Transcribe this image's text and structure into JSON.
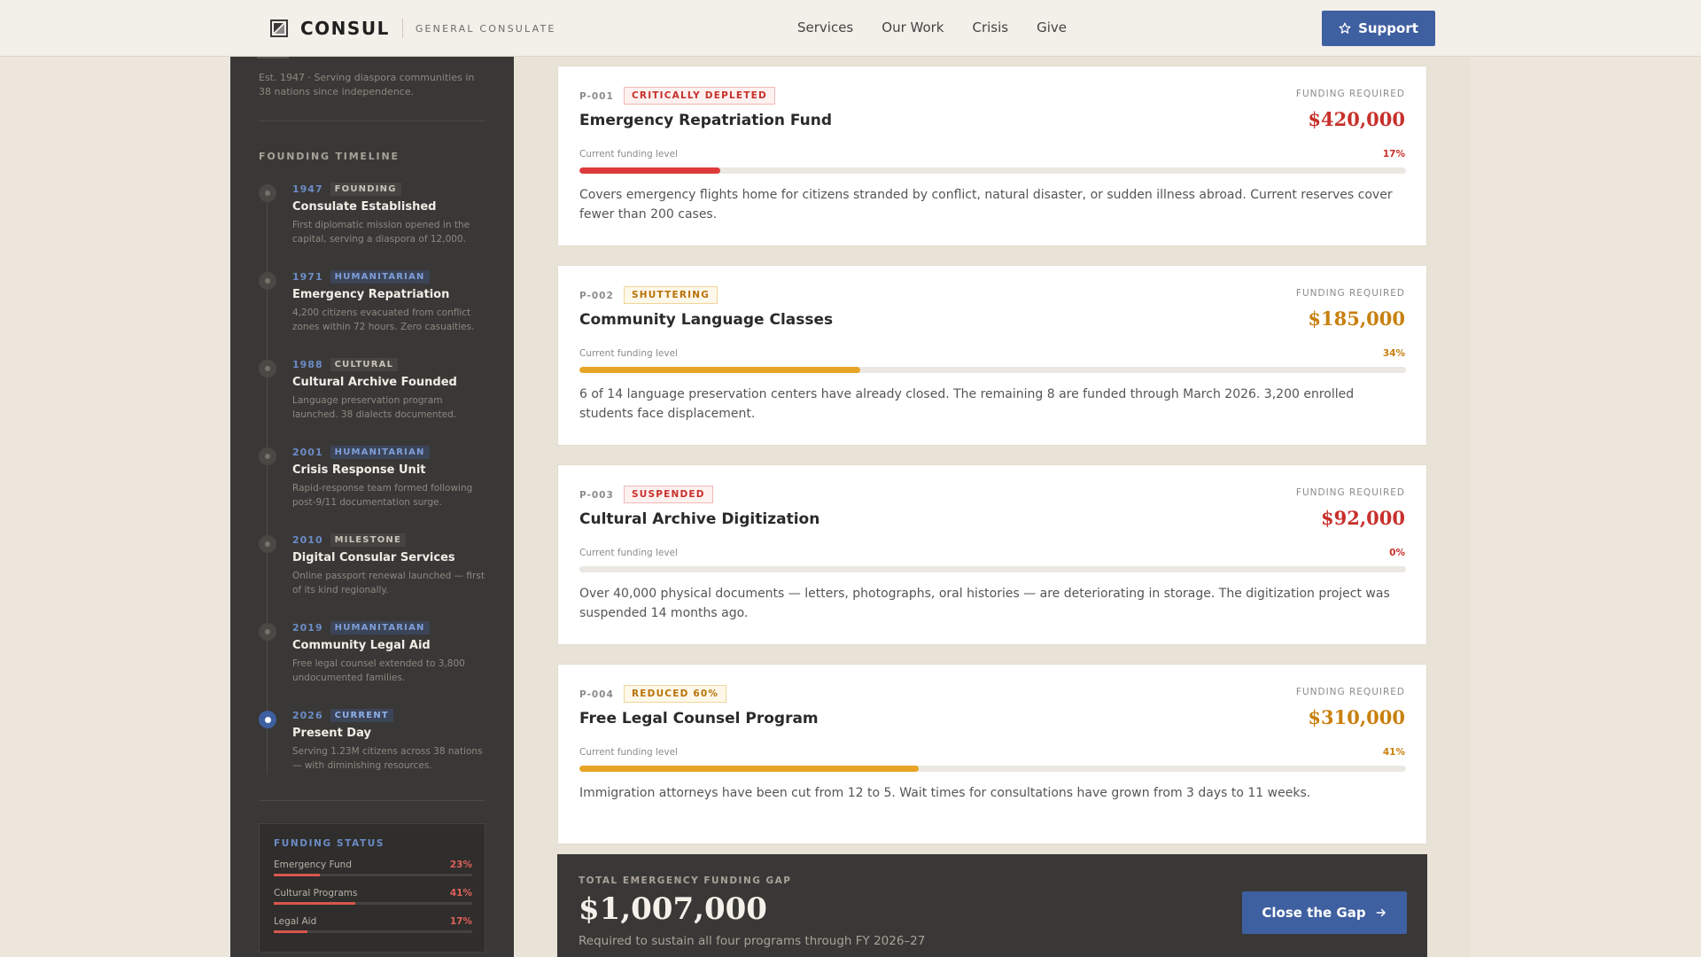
{
  "header": {
    "logo_name": "CONSUL",
    "logo_sub": "GENERAL CONSULATE",
    "nav": [
      "Services",
      "Our Work",
      "Crisis",
      "Give"
    ],
    "support_label": "Support"
  },
  "sidebar": {
    "est": "Est. 1947 · Serving diaspora communities in 38 nations since independence.",
    "timeline_heading": "FOUNDING TIMELINE",
    "timeline": [
      {
        "year": "1947",
        "tag": "FOUNDING",
        "title": "Consulate Established",
        "desc": "First diplomatic mission opened in the capital, serving a diaspora of 12,000."
      },
      {
        "year": "1971",
        "tag": "HUMANITARIAN",
        "title": "Emergency Repatriation",
        "desc": "4,200 citizens evacuated from conflict zones within 72 hours. Zero casualties."
      },
      {
        "year": "1988",
        "tag": "CULTURAL",
        "title": "Cultural Archive Founded",
        "desc": "Language preservation program launched. 38 dialects documented."
      },
      {
        "year": "2001",
        "tag": "HUMANITARIAN",
        "title": "Crisis Response Unit",
        "desc": "Rapid-response team formed following post-9/11 documentation surge."
      },
      {
        "year": "2010",
        "tag": "MILESTONE",
        "title": "Digital Consular Services",
        "desc": "Online passport renewal launched — first of its kind regionally."
      },
      {
        "year": "2019",
        "tag": "HUMANITARIAN",
        "title": "Community Legal Aid",
        "desc": "Free legal counsel extended to 3,800 undocumented families."
      },
      {
        "year": "2026",
        "tag": "CURRENT",
        "title": "Present Day",
        "desc": "Serving 1.23M citizens across 38 nations — with diminishing resources."
      }
    ],
    "funding_heading": "FUNDING STATUS",
    "funding": [
      {
        "label": "Emergency Fund",
        "pct": "23%",
        "value": 0.23
      },
      {
        "label": "Cultural Programs",
        "pct": "41%",
        "value": 0.41
      },
      {
        "label": "Legal Aid",
        "pct": "17%",
        "value": 0.17
      }
    ]
  },
  "programs": [
    {
      "code": "P-001",
      "status": "CRITICALLY DEPLETED",
      "tone": "red",
      "title": "Emergency Repatriation Fund",
      "req_label": "FUNDING REQUIRED",
      "amount": "$420,000",
      "level_label": "Current funding level",
      "pct": "17%",
      "level": 0.17,
      "desc": "Covers emergency flights home for citizens stranded by conflict, natural disaster, or sudden illness abroad. Current reserves cover fewer than 200 cases."
    },
    {
      "code": "P-002",
      "status": "SHUTTERING",
      "tone": "amber",
      "title": "Community Language Classes",
      "req_label": "FUNDING REQUIRED",
      "amount": "$185,000",
      "level_label": "Current funding level",
      "pct": "34%",
      "level": 0.34,
      "desc": "6 of 14 language preservation centers have already closed. The remaining 8 are funded through March 2026. 3,200 enrolled students face displacement."
    },
    {
      "code": "P-003",
      "status": "SUSPENDED",
      "tone": "red",
      "title": "Cultural Archive Digitization",
      "req_label": "FUNDING REQUIRED",
      "amount": "$92,000",
      "level_label": "Current funding level",
      "pct": "0%",
      "level": 0,
      "desc": "Over 40,000 physical documents — letters, photographs, oral histories — are deteriorating in storage. The digitization project was suspended 14 months ago."
    },
    {
      "code": "P-004",
      "status": "REDUCED 60%",
      "tone": "amber",
      "title": "Free Legal Counsel Program",
      "req_label": "FUNDING REQUIRED",
      "amount": "$310,000",
      "level_label": "Current funding level",
      "pct": "41%",
      "level": 0.41,
      "desc": "Immigration attorneys have been cut from 12 to 5. Wait times for consultations have grown from 3 days to 11 weeks."
    }
  ],
  "gap": {
    "label": "TOTAL EMERGENCY FUNDING GAP",
    "amount": "$1,007,000",
    "sub": "Required to sustain all four programs through FY 2026–27",
    "button_label": "Close the Gap"
  },
  "colors": {
    "accent": "#3e5fa0",
    "critical": "#c8302b",
    "warning": "#c8800e",
    "sidebar": "#393836"
  },
  "icons": {
    "support": "star-icon",
    "gap_button": "arrow-right-icon"
  }
}
